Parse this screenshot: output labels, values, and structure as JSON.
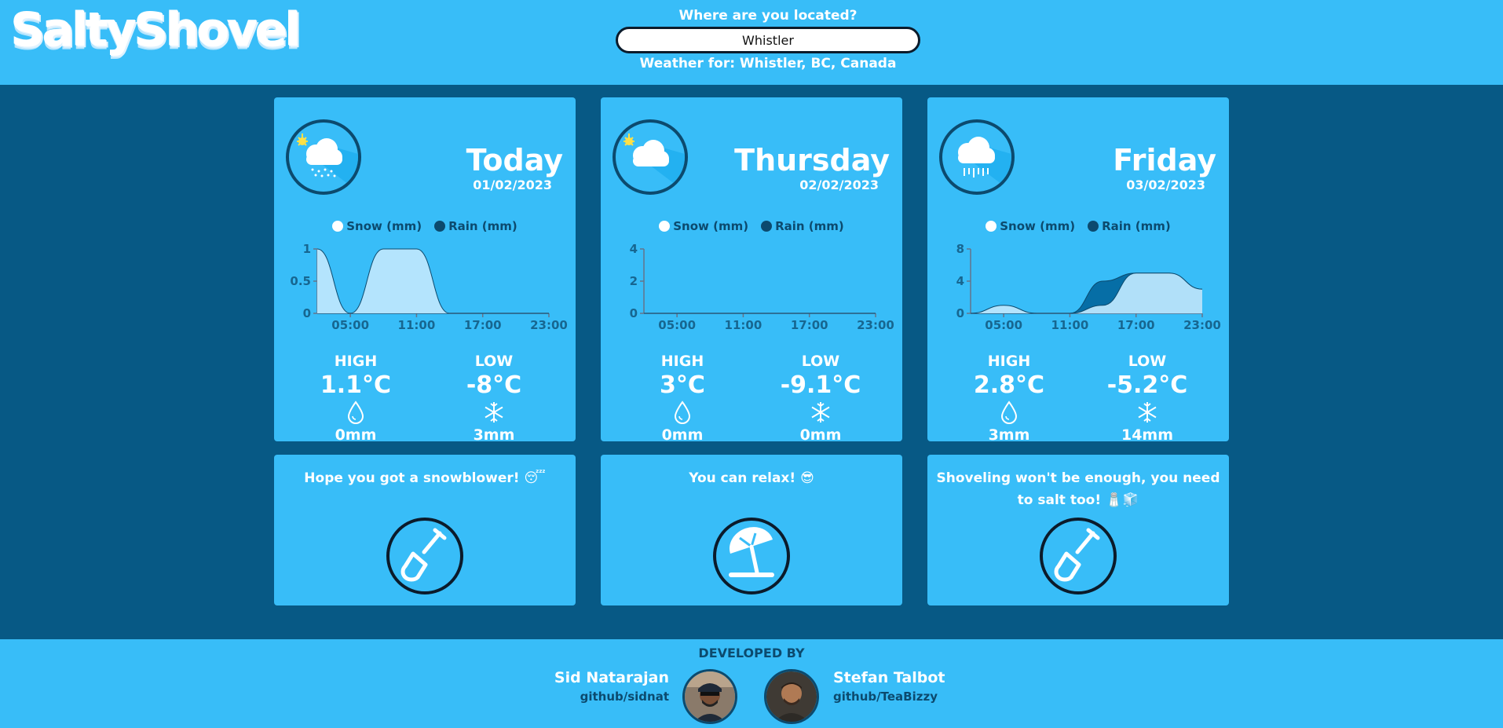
{
  "header": {
    "logo": "SaltyShovel",
    "location_label": "Where are you located?",
    "location_value": "Whistler",
    "weather_for": "Weather for: Whistler, BC, Canada"
  },
  "legend": {
    "snow": "Snow (mm)",
    "rain": "Rain (mm)"
  },
  "colors": {
    "snow": "#ffffff",
    "rain": "#0c4a6e",
    "snow_fill": "#bae6fd",
    "rain_fill": "#0369a1",
    "bg_light": "#38bdf8",
    "bg_dark": "#075985"
  },
  "forecasts": [
    {
      "day": "Today",
      "date": "01/02/2023",
      "icon": "sun-cloud-snow-icon",
      "high_label": "HIGH",
      "high": "1.1°C",
      "rain_icon": "droplet-icon",
      "rain": "0mm",
      "low_label": "LOW",
      "low": "-8°C",
      "snow_icon": "snowflake-icon",
      "snow": "3mm"
    },
    {
      "day": "Thursday",
      "date": "02/02/2023",
      "icon": "sun-cloud-icon",
      "high_label": "HIGH",
      "high": "3°C",
      "rain_icon": "droplet-icon",
      "rain": "0mm",
      "low_label": "LOW",
      "low": "-9.1°C",
      "snow_icon": "snowflake-icon",
      "snow": "0mm"
    },
    {
      "day": "Friday",
      "date": "03/02/2023",
      "icon": "cloud-rain-icon",
      "high_label": "HIGH",
      "high": "2.8°C",
      "rain_icon": "droplet-icon",
      "rain": "3mm",
      "low_label": "LOW",
      "low": "-5.2°C",
      "snow_icon": "snowflake-icon",
      "snow": "14mm"
    }
  ],
  "chart_data": [
    {
      "type": "area",
      "x": [
        "02:00",
        "05:00",
        "08:00",
        "11:00",
        "14:00",
        "17:00",
        "20:00",
        "23:00"
      ],
      "x_ticks": [
        "05:00",
        "11:00",
        "17:00",
        "23:00"
      ],
      "ylim": [
        0,
        1
      ],
      "y_ticks": [
        "0",
        "0.5",
        "1"
      ],
      "series": [
        {
          "name": "Snow (mm)",
          "values": [
            1,
            0,
            1,
            1,
            0,
            0,
            0,
            0
          ]
        },
        {
          "name": "Rain (mm)",
          "values": [
            0,
            0,
            0,
            0,
            0,
            0,
            0,
            0
          ]
        }
      ]
    },
    {
      "type": "area",
      "x": [
        "02:00",
        "05:00",
        "08:00",
        "11:00",
        "14:00",
        "17:00",
        "20:00",
        "23:00"
      ],
      "x_ticks": [
        "05:00",
        "11:00",
        "17:00",
        "23:00"
      ],
      "ylim": [
        0,
        4
      ],
      "y_ticks": [
        "0",
        "2",
        "4"
      ],
      "series": [
        {
          "name": "Snow (mm)",
          "values": [
            0,
            0,
            0,
            0,
            0,
            0,
            0,
            0
          ]
        },
        {
          "name": "Rain (mm)",
          "values": [
            0,
            0,
            0,
            0,
            0,
            0,
            0,
            0
          ]
        }
      ]
    },
    {
      "type": "area",
      "x": [
        "02:00",
        "05:00",
        "08:00",
        "11:00",
        "14:00",
        "17:00",
        "20:00",
        "23:00"
      ],
      "x_ticks": [
        "05:00",
        "11:00",
        "17:00",
        "23:00"
      ],
      "ylim": [
        0,
        8
      ],
      "y_ticks": [
        "0",
        "4",
        "8"
      ],
      "series": [
        {
          "name": "Snow (mm)",
          "values": [
            0,
            1,
            0,
            0,
            1,
            5,
            5,
            3
          ]
        },
        {
          "name": "Rain (mm)",
          "values": [
            0,
            0,
            0,
            0,
            4,
            5,
            5,
            3
          ]
        }
      ]
    }
  ],
  "advice": [
    {
      "text": "Hope you got a snowblower! 😴",
      "icon": "shovel-icon"
    },
    {
      "text": "You can relax! 😎",
      "icon": "beach-umbrella-icon"
    },
    {
      "text": "Shoveling won't be enough, you need to salt too! 🧂🧊",
      "icon": "shovel-icon"
    }
  ],
  "footer": {
    "developed_by": "DEVELOPED BY",
    "devs": [
      {
        "name": "Sid Natarajan",
        "github": "github/sidnat"
      },
      {
        "name": "Stefan Talbot",
        "github": "github/TeaBizzy"
      }
    ]
  }
}
